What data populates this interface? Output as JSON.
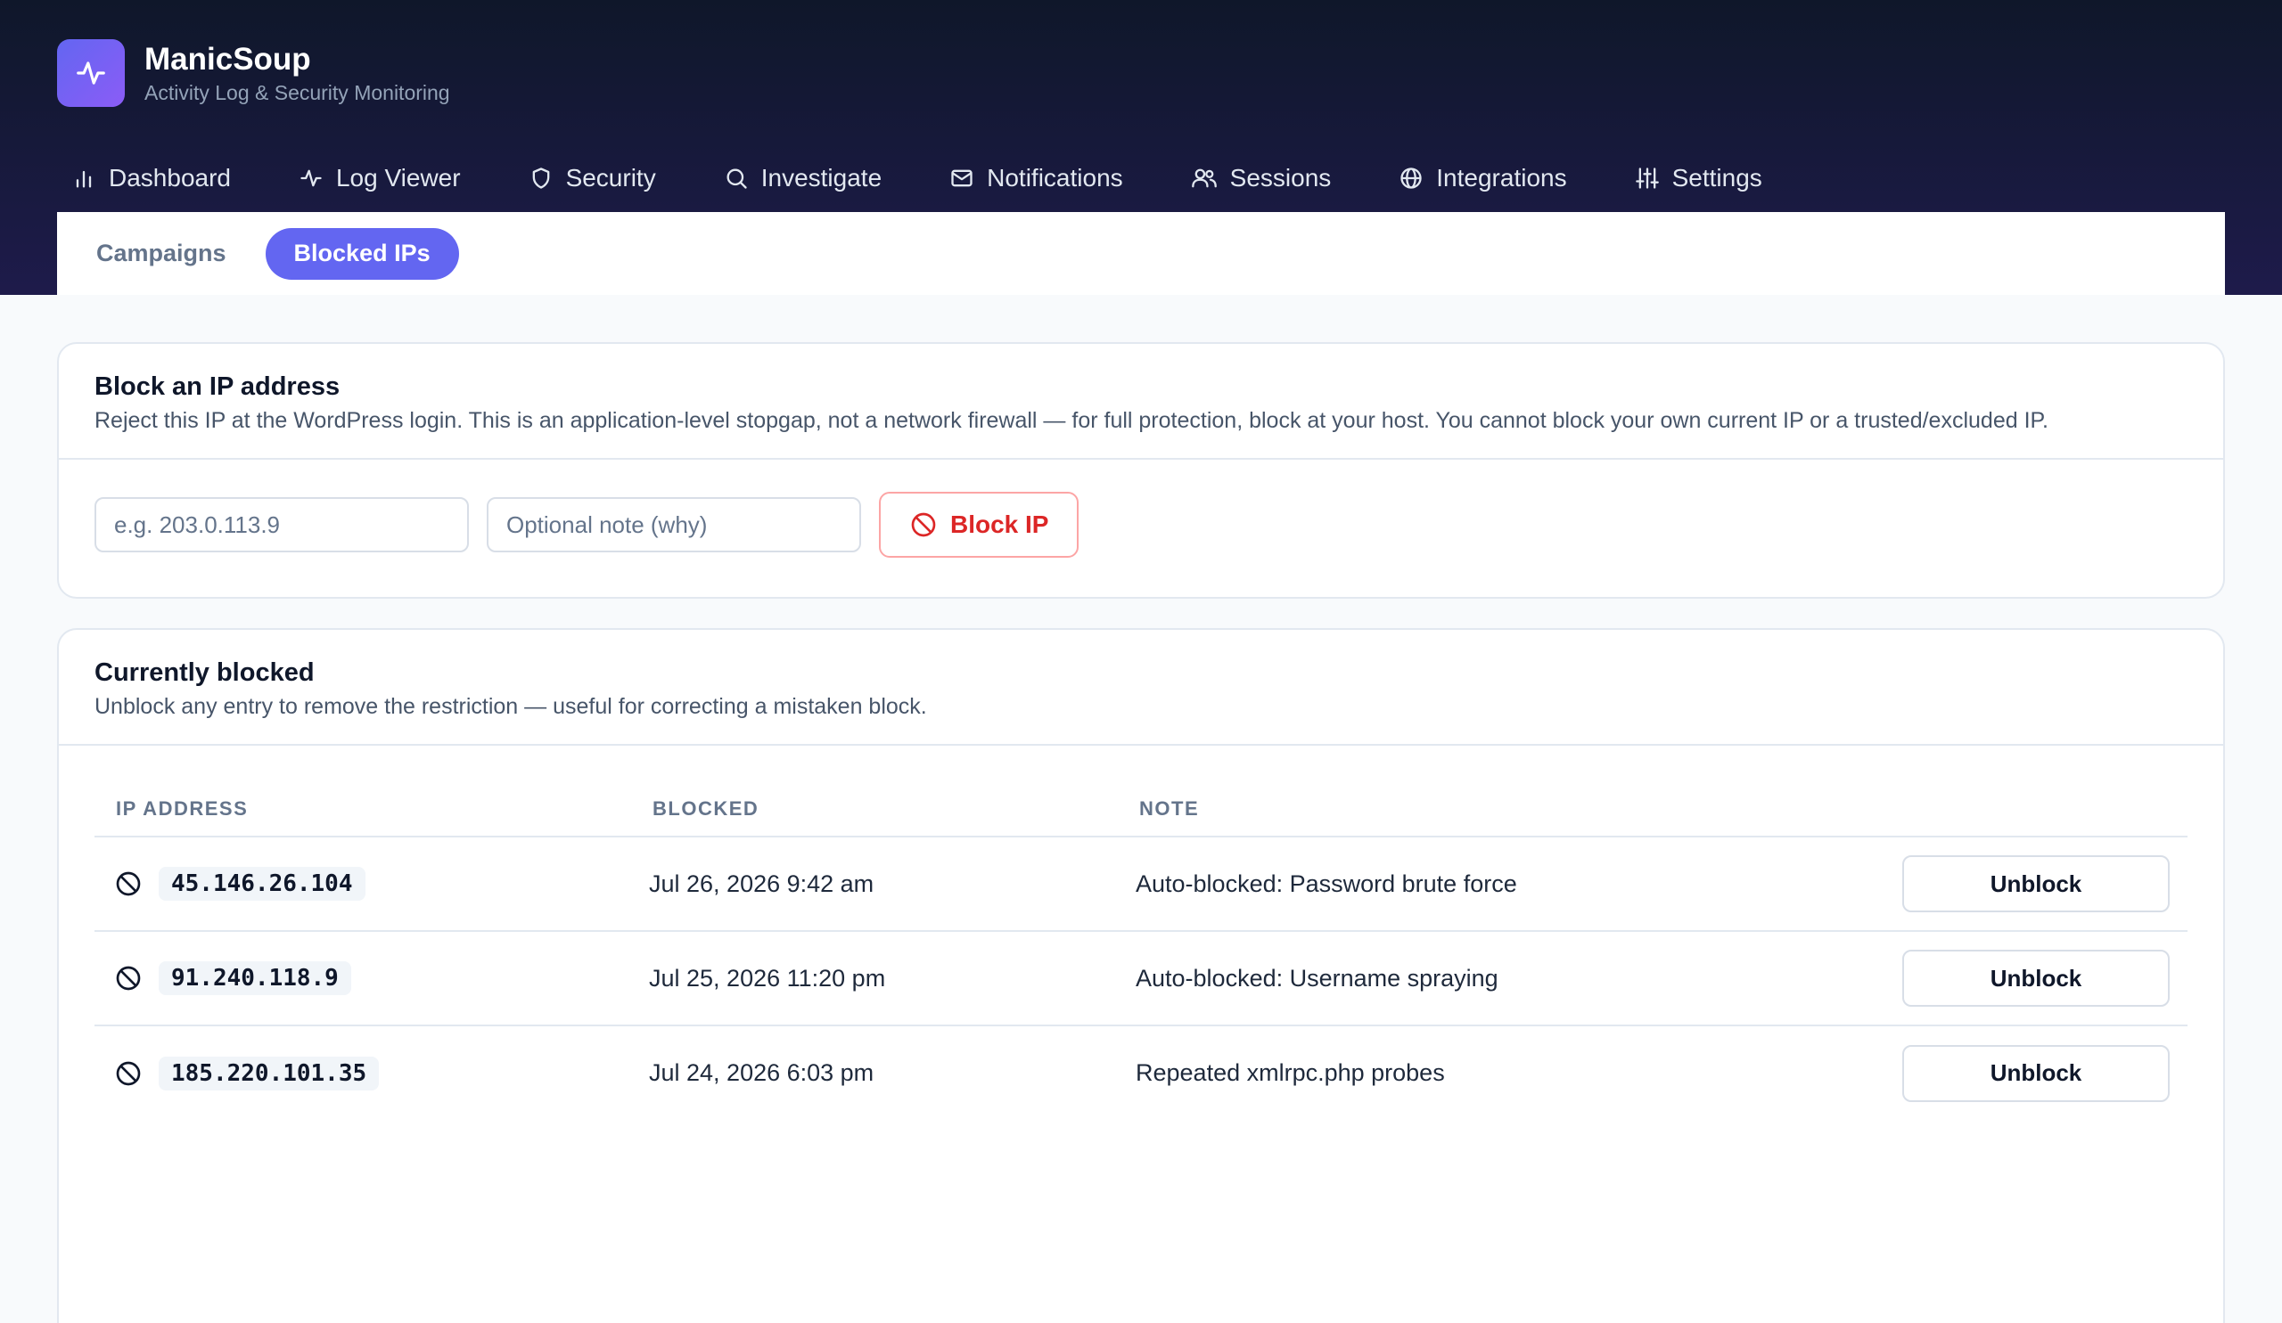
{
  "app": {
    "name": "ManicSoup",
    "subtitle": "Activity Log & Security Monitoring"
  },
  "nav": {
    "items": [
      {
        "label": "Dashboard",
        "icon": "bar-chart-icon"
      },
      {
        "label": "Log Viewer",
        "icon": "activity-icon"
      },
      {
        "label": "Security",
        "icon": "shield-icon"
      },
      {
        "label": "Investigate",
        "icon": "search-icon"
      },
      {
        "label": "Notifications",
        "icon": "mail-icon"
      },
      {
        "label": "Sessions",
        "icon": "users-icon"
      },
      {
        "label": "Integrations",
        "icon": "globe-icon"
      },
      {
        "label": "Settings",
        "icon": "sliders-icon"
      }
    ]
  },
  "subtabs": {
    "items": [
      {
        "label": "Campaigns",
        "active": false
      },
      {
        "label": "Blocked IPs",
        "active": true
      }
    ]
  },
  "block_form": {
    "title": "Block an IP address",
    "description": "Reject this IP at the WordPress login. This is an application-level stopgap, not a network firewall — for full protection, block at your host. You cannot block your own current IP or a trusted/excluded IP.",
    "ip_placeholder": "e.g. 203.0.113.9",
    "ip_value": "",
    "note_placeholder": "Optional note (why)",
    "note_value": "",
    "button_label": "Block IP"
  },
  "blocked": {
    "title": "Currently blocked",
    "description": "Unblock any entry to remove the restriction — useful for correcting a mistaken block.",
    "columns": {
      "ip": "IP ADDRESS",
      "blocked": "BLOCKED",
      "note": "NOTE"
    },
    "rows": [
      {
        "ip": "45.146.26.104",
        "blocked": "Jul 26, 2026 9:42 am",
        "note": "Auto-blocked: Password brute force",
        "action": "Unblock"
      },
      {
        "ip": "91.240.118.9",
        "blocked": "Jul 25, 2026 11:20 pm",
        "note": "Auto-blocked: Username spraying",
        "action": "Unblock"
      },
      {
        "ip": "185.220.101.35",
        "blocked": "Jul 24, 2026 6:03 pm",
        "note": "Repeated xmlrpc.php probes",
        "action": "Unblock"
      }
    ]
  },
  "colors": {
    "accent": "#6366f1",
    "danger": "#dc2626",
    "header_bg": "#0f172a"
  }
}
